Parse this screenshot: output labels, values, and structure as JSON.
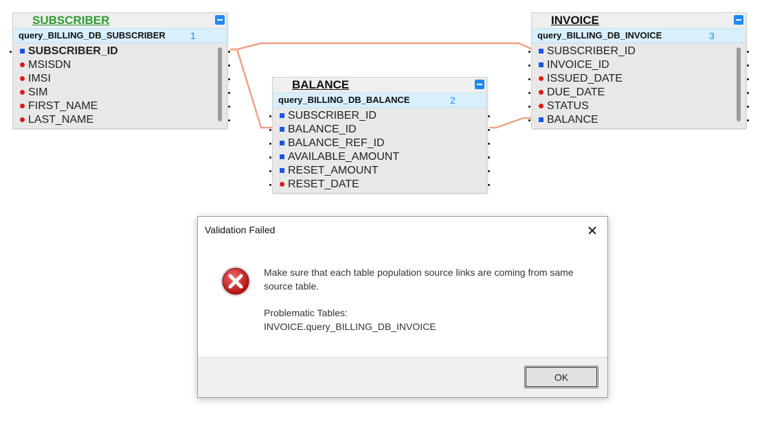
{
  "tables": {
    "subscriber": {
      "name": "SUBSCRIBER",
      "query": "query_BILLING_DB_SUBSCRIBER",
      "number": "1",
      "fields": [
        {
          "label": "SUBSCRIBER_ID",
          "marker": "key"
        },
        {
          "label": "MSISDN",
          "marker": "required"
        },
        {
          "label": "IMSI",
          "marker": "required"
        },
        {
          "label": "SIM",
          "marker": "required"
        },
        {
          "label": "FIRST_NAME",
          "marker": "required"
        },
        {
          "label": "LAST_NAME",
          "marker": "required"
        }
      ]
    },
    "balance": {
      "name": "BALANCE",
      "query": "query_BILLING_DB_BALANCE",
      "number": "2",
      "fields": [
        {
          "label": "SUBSCRIBER_ID",
          "marker": "key"
        },
        {
          "label": "BALANCE_ID",
          "marker": "key"
        },
        {
          "label": "BALANCE_REF_ID",
          "marker": "key"
        },
        {
          "label": "AVAILABLE_AMOUNT",
          "marker": "key"
        },
        {
          "label": "RESET_AMOUNT",
          "marker": "key"
        },
        {
          "label": "RESET_DATE",
          "marker": "required"
        }
      ]
    },
    "invoice": {
      "name": "INVOICE",
      "query": "query_BILLING_DB_INVOICE",
      "number": "3",
      "fields": [
        {
          "label": "SUBSCRIBER_ID",
          "marker": "key"
        },
        {
          "label": "INVOICE_ID",
          "marker": "key"
        },
        {
          "label": "ISSUED_DATE",
          "marker": "required"
        },
        {
          "label": "DUE_DATE",
          "marker": "required"
        },
        {
          "label": "STATUS",
          "marker": "required"
        },
        {
          "label": "BALANCE",
          "marker": "key"
        }
      ]
    }
  },
  "colors": {
    "link": "#f0a083",
    "key_marker": "#1a55e6",
    "required_marker": "#e01818",
    "subscriber_title": "#2e9a2e",
    "query_band": "#d8f0fb",
    "query_number": "#1e8bf5"
  },
  "dialog": {
    "title": "Validation Failed",
    "message": "Make sure that each table population source links are coming from same source table.",
    "problem_label": "Problematic Tables:",
    "problem_value": "INVOICE.query_BILLING_DB_INVOICE",
    "ok_label": "OK",
    "icon": "error-icon"
  }
}
